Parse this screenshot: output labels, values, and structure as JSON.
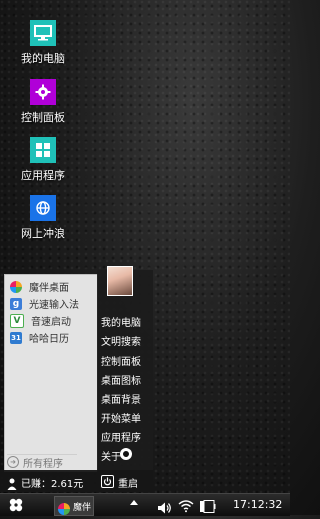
{
  "desktop": {
    "icons": [
      {
        "label": "我的电脑",
        "color": "#1fc1b8",
        "icon": "monitor-icon"
      },
      {
        "label": "控制面板",
        "color": "#b000d8",
        "icon": "gear-icon"
      },
      {
        "label": "应用程序",
        "color": "#1fc1b8",
        "icon": "grid-icon"
      },
      {
        "label": "网上冲浪",
        "color": "#1a73e8",
        "icon": "globe-icon"
      }
    ]
  },
  "start_menu": {
    "apps": [
      {
        "label": "魔伴桌面",
        "icon": "pinwheel-icon"
      },
      {
        "label": "光速输入法",
        "icon": "g-icon",
        "glyph": "g"
      },
      {
        "label": "音速启动",
        "icon": "v-icon",
        "glyph": "V"
      },
      {
        "label": "哈哈日历",
        "icon": "calendar-icon",
        "glyph": "31"
      }
    ],
    "all_programs_label": "所有程序",
    "right_items": [
      "我的电脑",
      "文明搜索",
      "控制面板",
      "桌面图标",
      "桌面背景",
      "开始菜单",
      "应用程序",
      "关于"
    ],
    "earned_label": "已赚：2.61元",
    "restart_label": "重启"
  },
  "taskbar": {
    "app_label": "魔伴",
    "clock": "17:12:32"
  },
  "colors": {
    "accent": "#1fc1b8",
    "control_panel": "#b000d8",
    "web": "#1a73e8"
  }
}
